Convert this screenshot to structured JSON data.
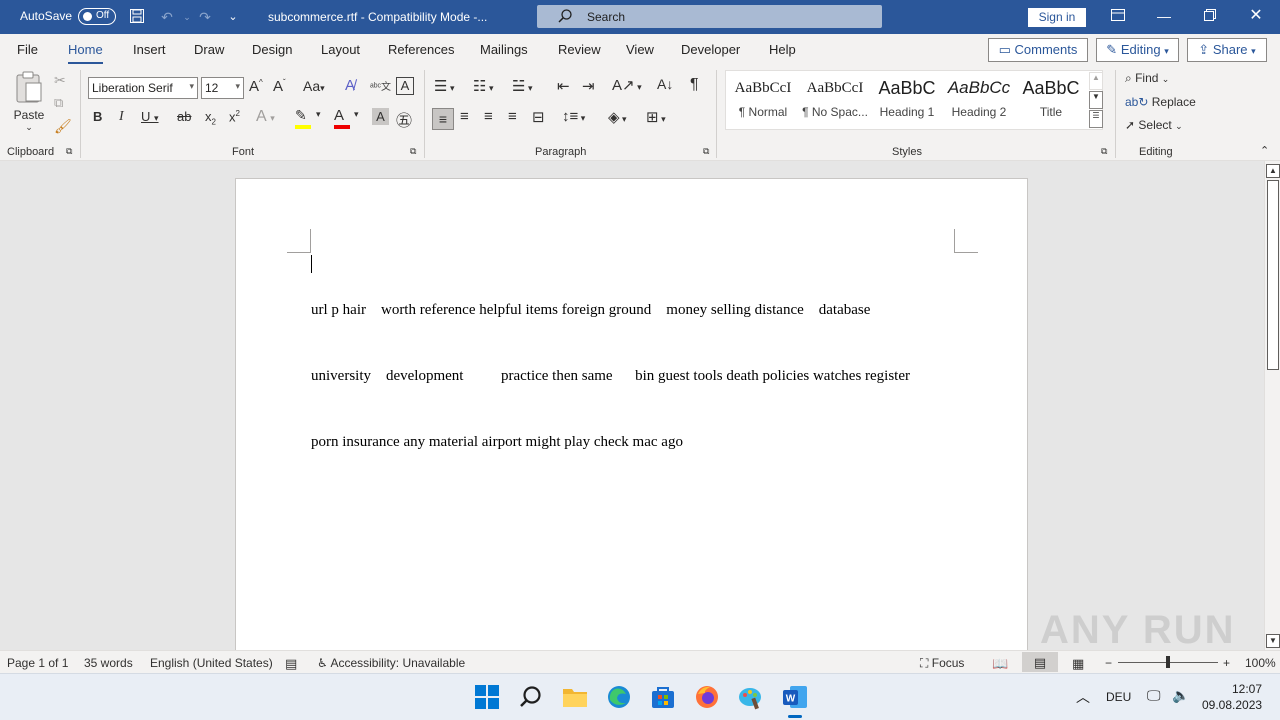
{
  "titlebar": {
    "autosave_label": "AutoSave",
    "autosave_state": "Off",
    "doc_title": "subcommerce.rtf  -  Compatibility Mode  -...",
    "search_label": "Search",
    "signin_label": "Sign in"
  },
  "menu": {
    "tabs": [
      "File",
      "Home",
      "Insert",
      "Draw",
      "Design",
      "Layout",
      "References",
      "Mailings",
      "Review",
      "View",
      "Developer",
      "Help"
    ],
    "comments_label": "Comments",
    "editing_label": "Editing",
    "share_label": "Share"
  },
  "ribbon": {
    "clipboard_label": "Clipboard",
    "paste_label": "Paste",
    "font_group_label": "Font",
    "font_name": "Liberation Serif",
    "font_size": "12",
    "paragraph_label": "Paragraph",
    "styles_label": "Styles",
    "styles": [
      {
        "preview": "AaBbCcI",
        "name": "¶ Normal"
      },
      {
        "preview": "AaBbCcI",
        "name": "¶ No Spac..."
      },
      {
        "preview": "AaBbC",
        "name": "Heading 1"
      },
      {
        "preview": "AaBbCc",
        "name": "Heading 2"
      },
      {
        "preview": "AaBbC",
        "name": "Title"
      }
    ],
    "editing_group_label": "Editing",
    "find_label": "Find",
    "replace_label": "Replace",
    "select_label": "Select"
  },
  "document": {
    "line1": "url p hair    worth reference helpful items foreign ground    money selling distance    database",
    "line2": "university    development          practice then same      bin guest tools death policies watches register",
    "line3": "porn insurance any material airport might play check mac ago"
  },
  "status": {
    "page": "Page 1 of 1",
    "words": "35 words",
    "language": "English (United States)",
    "accessibility": "Accessibility: Unavailable",
    "focus": "Focus",
    "zoom": "100%"
  },
  "taskbar": {
    "lang": "DEU",
    "time": "12:07",
    "date": "09.08.2023"
  },
  "watermark": "ANY RUN"
}
